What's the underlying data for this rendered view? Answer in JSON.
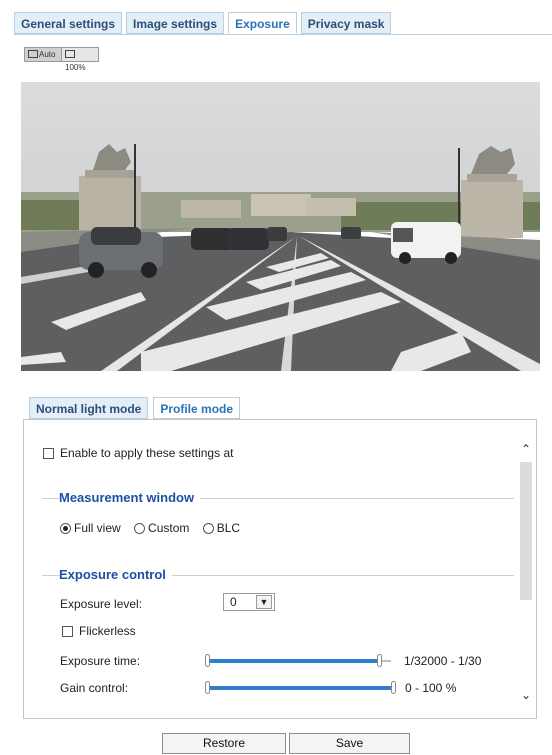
{
  "tabs": {
    "general": "General settings",
    "image": "Image settings",
    "exposure": "Exposure",
    "privacy": "Privacy mask"
  },
  "zoom": {
    "auto": "Auto",
    "full": "100%"
  },
  "mode_tabs": {
    "normal": "Normal light mode",
    "profile": "Profile mode"
  },
  "panel": {
    "enable_label": "Enable to apply these settings at",
    "measurement": {
      "title": "Measurement window",
      "options": [
        "Full view",
        "Custom",
        "BLC"
      ],
      "selected": "Full view"
    },
    "exposure_control": {
      "title": "Exposure control",
      "level_label": "Exposure level:",
      "level_value": "0",
      "flickerless_label": "Flickerless",
      "time_label": "Exposure time:",
      "time_range": "1/32000 - 1/30",
      "time_slider": {
        "min": 0.0,
        "max": 0.95
      },
      "gain_label": "Gain control:",
      "gain_range": "0 - 100 %",
      "gain_slider": {
        "min": 0.0,
        "max": 1.0
      }
    }
  },
  "buttons": {
    "restore": "Restore",
    "save": "Save"
  },
  "colors": {
    "accent": "#2a73b8",
    "section_title": "#1f4fa3",
    "slider_fill": "#2e7fce"
  },
  "icons": {
    "scroll_up": "chevron-up-icon",
    "scroll_down": "chevron-down-icon"
  }
}
